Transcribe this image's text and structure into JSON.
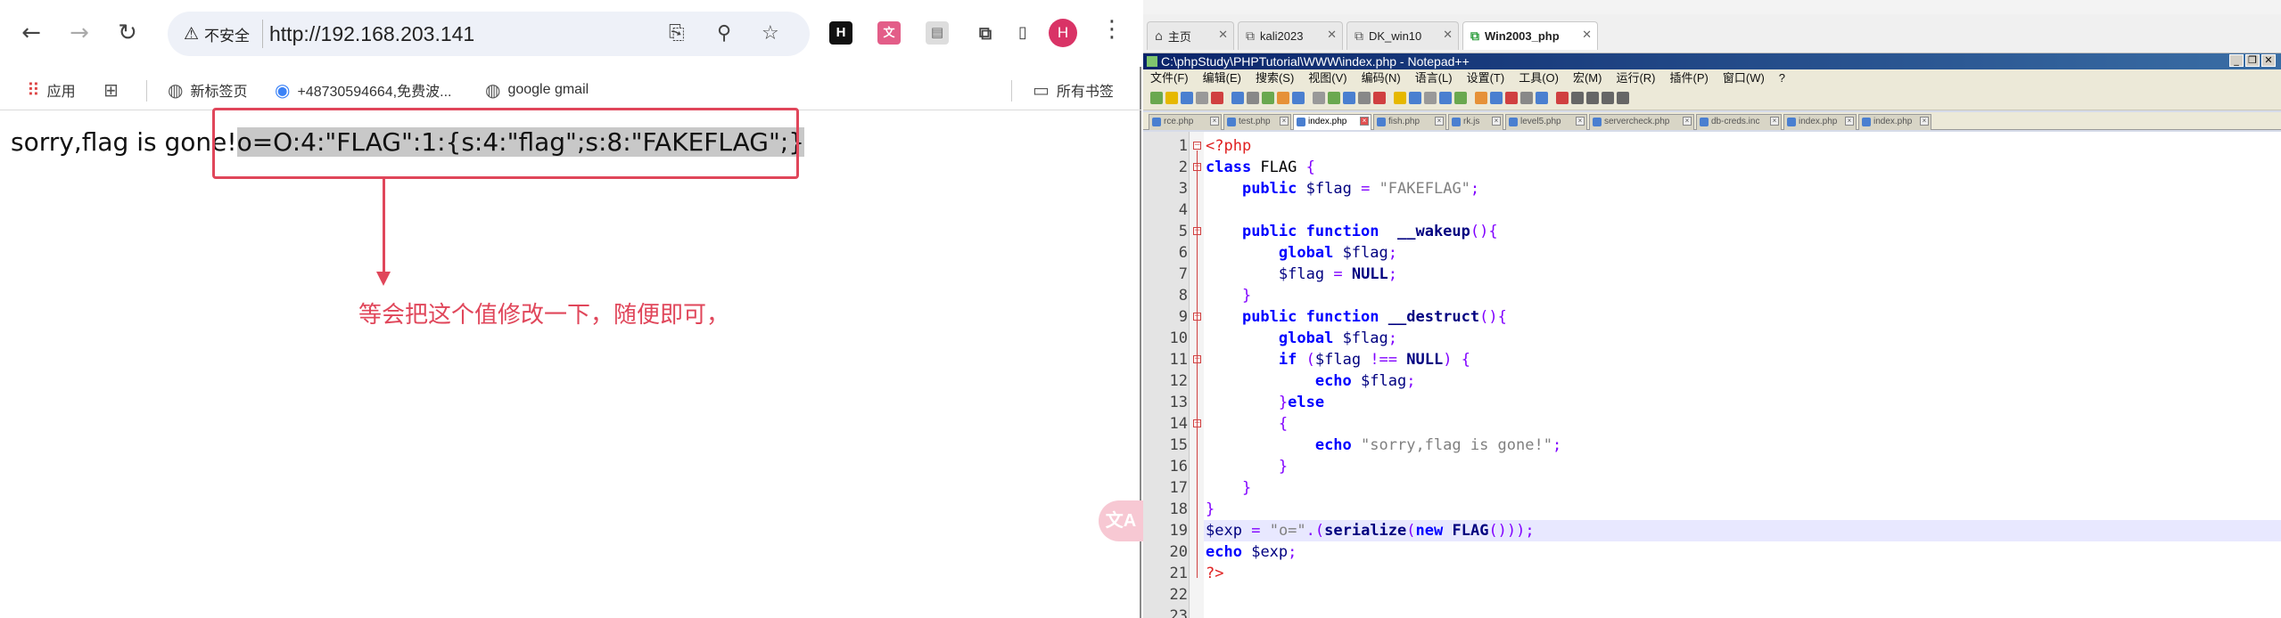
{
  "browser": {
    "security_label": "不安全",
    "url": "http://192.168.203.141",
    "avatar_letter": "H",
    "bookmarks": [
      "应用",
      "新标签页",
      "+48730594664,免费波...",
      "google gmail",
      "所有书签"
    ],
    "page_text_prefix": "sorry,flag is gone!",
    "page_text_selected": "o=O:4:\"FLAG\":1:{s:4:\"flag\";s:8:\"FAKEFLAG\";}",
    "annotation": "等会把这个值修改一下，随便即可，",
    "colors": {
      "annotation": "#e0465a",
      "selection": "#c8c8c8",
      "avatar": "#d93366"
    }
  },
  "vm": {
    "tabs": [
      "主页",
      "kali2023",
      "DK_win10",
      "Win2003_php"
    ],
    "active_tab": "Win2003_php"
  },
  "notepad": {
    "title": "C:\\phpStudy\\PHPTutorial\\WWW\\index.php - Notepad++",
    "menu": [
      "文件(F)",
      "编辑(E)",
      "搜索(S)",
      "视图(V)",
      "编码(N)",
      "语言(L)",
      "设置(T)",
      "工具(O)",
      "宏(M)",
      "运行(R)",
      "插件(P)",
      "窗口(W)",
      "?"
    ],
    "doc_tabs": [
      "rce.php",
      "test.php",
      "index.php",
      "fish.php",
      "rk.js",
      "level5.php",
      "servercheck.php",
      "db-creds.inc",
      "index.php",
      "index.php"
    ],
    "active_doc_tab": "index.php",
    "line_numbers": [
      "1",
      "2",
      "3",
      "4",
      "5",
      "6",
      "7",
      "8",
      "9",
      "10",
      "11",
      "12",
      "13",
      "14",
      "15",
      "16",
      "17",
      "18",
      "19",
      "20",
      "21",
      "22",
      "23"
    ],
    "code_lines": [
      [
        [
          "php",
          "<?php"
        ]
      ],
      [
        [
          "kw",
          "class"
        ],
        [
          "plain",
          " FLAG "
        ],
        [
          "op",
          "{"
        ]
      ],
      [
        [
          "plain",
          "    "
        ],
        [
          "kw",
          "public"
        ],
        [
          "plain",
          " "
        ],
        [
          "var",
          "$flag"
        ],
        [
          "plain",
          " "
        ],
        [
          "op",
          "="
        ],
        [
          "plain",
          " "
        ],
        [
          "str",
          "\"FAKEFLAG\""
        ],
        [
          "op",
          ";"
        ]
      ],
      [],
      [
        [
          "plain",
          "    "
        ],
        [
          "kw",
          "public"
        ],
        [
          "plain",
          " "
        ],
        [
          "kw",
          "function"
        ],
        [
          "plain",
          "  "
        ],
        [
          "fn",
          "__wakeup"
        ],
        [
          "op",
          "(){"
        ]
      ],
      [
        [
          "plain",
          "        "
        ],
        [
          "kw",
          "global"
        ],
        [
          "plain",
          " "
        ],
        [
          "var",
          "$flag"
        ],
        [
          "op",
          ";"
        ]
      ],
      [
        [
          "plain",
          "        "
        ],
        [
          "var",
          "$flag"
        ],
        [
          "plain",
          " "
        ],
        [
          "op",
          "="
        ],
        [
          "plain",
          " "
        ],
        [
          "fn",
          "NULL"
        ],
        [
          "op",
          ";"
        ]
      ],
      [
        [
          "plain",
          "    "
        ],
        [
          "op",
          "}"
        ]
      ],
      [
        [
          "plain",
          "    "
        ],
        [
          "kw",
          "public"
        ],
        [
          "plain",
          " "
        ],
        [
          "kw",
          "function"
        ],
        [
          "plain",
          " "
        ],
        [
          "fn",
          "__destruct"
        ],
        [
          "op",
          "(){"
        ]
      ],
      [
        [
          "plain",
          "        "
        ],
        [
          "kw",
          "global"
        ],
        [
          "plain",
          " "
        ],
        [
          "var",
          "$flag"
        ],
        [
          "op",
          ";"
        ]
      ],
      [
        [
          "plain",
          "        "
        ],
        [
          "kw",
          "if"
        ],
        [
          "plain",
          " "
        ],
        [
          "op",
          "("
        ],
        [
          "var",
          "$flag"
        ],
        [
          "plain",
          " "
        ],
        [
          "op",
          "!=="
        ],
        [
          "plain",
          " "
        ],
        [
          "fn",
          "NULL"
        ],
        [
          "op",
          ")"
        ],
        [
          "plain",
          " "
        ],
        [
          "op",
          "{"
        ]
      ],
      [
        [
          "plain",
          "            "
        ],
        [
          "kw",
          "echo"
        ],
        [
          "plain",
          " "
        ],
        [
          "var",
          "$flag"
        ],
        [
          "op",
          ";"
        ]
      ],
      [
        [
          "plain",
          "        "
        ],
        [
          "op",
          "}"
        ],
        [
          "kw",
          "else"
        ]
      ],
      [
        [
          "plain",
          "        "
        ],
        [
          "op",
          "{"
        ]
      ],
      [
        [
          "plain",
          "            "
        ],
        [
          "kw",
          "echo"
        ],
        [
          "plain",
          " "
        ],
        [
          "str",
          "\"sorry,flag is gone!\""
        ],
        [
          "op",
          ";"
        ]
      ],
      [
        [
          "plain",
          "        "
        ],
        [
          "op",
          "}"
        ]
      ],
      [
        [
          "plain",
          "    "
        ],
        [
          "op",
          "}"
        ]
      ],
      [
        [
          "op",
          "}"
        ]
      ],
      [
        [
          "var",
          "$exp"
        ],
        [
          "plain",
          " "
        ],
        [
          "op",
          "="
        ],
        [
          "plain",
          " "
        ],
        [
          "str",
          "\"o=\""
        ],
        [
          "op",
          ".("
        ],
        [
          "fn",
          "serialize"
        ],
        [
          "op",
          "("
        ],
        [
          "kw",
          "new"
        ],
        [
          "plain",
          " "
        ],
        [
          "fn",
          "FLAG"
        ],
        [
          "op",
          "()));"
        ]
      ],
      [
        [
          "kw",
          "echo"
        ],
        [
          "plain",
          " "
        ],
        [
          "var",
          "$exp"
        ],
        [
          "op",
          ";"
        ]
      ],
      [
        [
          "php",
          "?>"
        ]
      ],
      [],
      []
    ]
  }
}
